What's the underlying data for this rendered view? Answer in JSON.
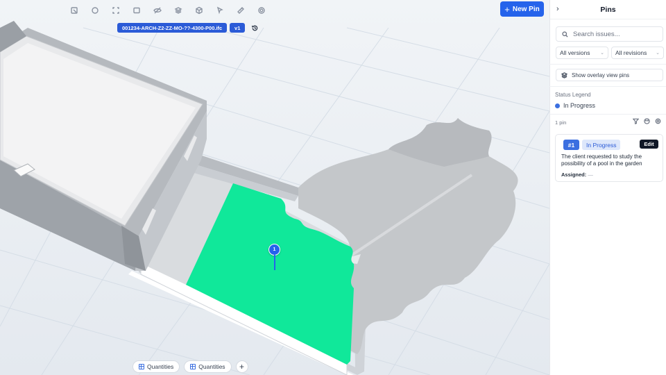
{
  "toolbar": {
    "icons": [
      "select-box-icon",
      "orbit-icon",
      "expand-icon",
      "frame-icon",
      "visibility-icon",
      "layers-icon",
      "cube-icon",
      "pointer-icon",
      "ruler-icon",
      "settings-icon"
    ],
    "new_pin_label": "New Pin"
  },
  "file": {
    "name": "001234-ARCH-Z2-ZZ-MO-??-4300-P00.ifc",
    "version": "v1"
  },
  "bottom": {
    "quantities_1": "Quantities",
    "quantities_2": "Quantities",
    "add": "+"
  },
  "marker": {
    "label": "1"
  },
  "sidebar": {
    "title": "Pins",
    "search_placeholder": "Search issues...",
    "versions": "All versions",
    "revisions": "All revisions",
    "overlay": "Show overlay view pins",
    "legend_title": "Status Legend",
    "legend_item": "In Progress",
    "pin_count": "1 pin",
    "card": {
      "number": "#1",
      "status": "In Progress",
      "edit": "Edit",
      "description": "The client requested to study the possibility of a pool in the garden",
      "assigned_label": "Assigned:",
      "assigned_value": "—"
    }
  },
  "colors": {
    "accent": "#2563eb",
    "pool": "#10e89a",
    "status_in_progress": "#3b6fe0"
  }
}
